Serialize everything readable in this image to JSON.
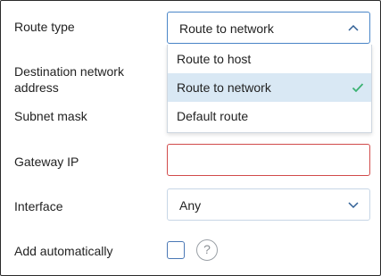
{
  "form": {
    "route_type": {
      "label": "Route type",
      "selected": "Route to network",
      "options": [
        "Route to host",
        "Route to network",
        "Default route"
      ],
      "selected_index": 1
    },
    "destination": {
      "label": "Destination network address"
    },
    "subnet_mask": {
      "label": "Subnet mask"
    },
    "gateway": {
      "label": "Gateway IP",
      "value": ""
    },
    "interface": {
      "label": "Interface",
      "selected": "Any"
    },
    "add_automatically": {
      "label": "Add automatically",
      "checked": false,
      "help_icon": "question-icon",
      "help_glyph": "?"
    }
  },
  "colors": {
    "accent": "#4a86c8",
    "invalid": "#d14b4b",
    "selected_bg": "#d9e8f4",
    "check": "#3bb273"
  }
}
